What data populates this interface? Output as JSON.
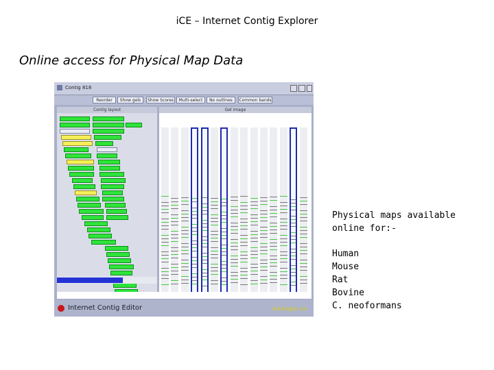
{
  "title": "iCE – Internet Contig Explorer",
  "subtitle": "Online access for Physical Map Data",
  "screenshot": {
    "window_title": "Contig 818",
    "toolbar_buttons": [
      "Reorder",
      "Show gels",
      "Show Scores",
      "Multi-select",
      "No outlines",
      "Common bands"
    ],
    "left_pane_header": "Contig layout",
    "right_pane_header": "Gel image",
    "footer_app_name": "Internet Contig Editor",
    "footer_url": "ice.bcgsc.ca"
  },
  "availability_text": "Physical maps available online for:-",
  "species": [
    "Human",
    "Mouse",
    "Rat",
    "Bovine",
    "C. neoformans"
  ],
  "colors": {
    "clone_box": "#2fe33a",
    "selected_clone": "#f5f05a",
    "selected_lane": "#1a2ab0",
    "footer_logo": "#c8161b"
  }
}
